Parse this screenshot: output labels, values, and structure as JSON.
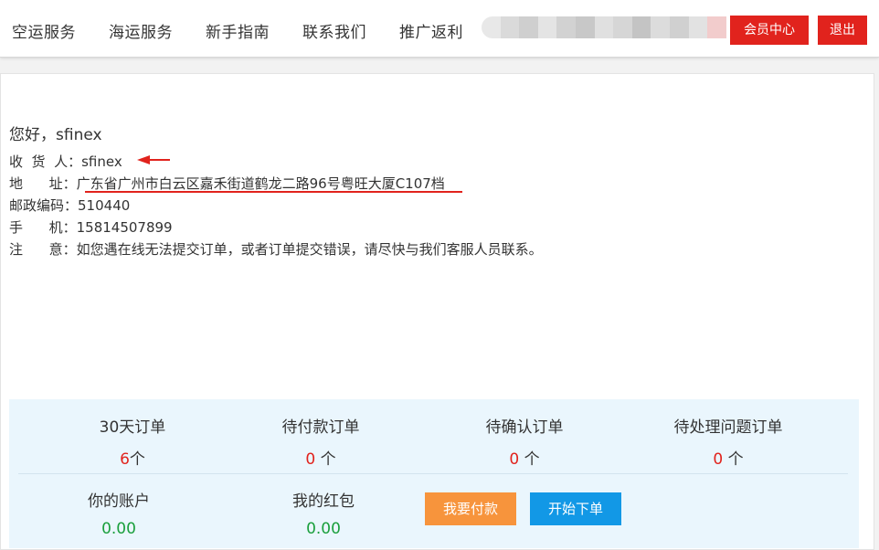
{
  "nav": {
    "items": [
      "空运服务",
      "海运服务",
      "新手指南",
      "联系我们",
      "推广返利"
    ],
    "member_center": "会员中心",
    "logout": "退出",
    "blur_colors": [
      "#e8e8e8",
      "#dadada",
      "#cfcfcf",
      "#e4e4e4",
      "#d2d2d2",
      "#c8c8c8",
      "#e0e0e0",
      "#d6d6d6",
      "#c4c4c4",
      "#dcdcdc",
      "#d0d0d0",
      "#e2e2e2",
      "#f2cccc"
    ]
  },
  "profile": {
    "greeting": "您好，sfinex",
    "receiver_label": "收  货  人：",
    "receiver": "sfinex",
    "address_label": "地      址：",
    "address": "广东省广州市白云区嘉禾街道鹤龙二路96号粤旺大厦C107档",
    "postcode_label": "邮政编码：",
    "postcode": "510440",
    "phone_label": "手      机：",
    "phone": "15814507899",
    "note_label": "注      意：",
    "note": "如您遇在线无法提交订单，或者订单提交错误，请尽快与我们客服人员联系。"
  },
  "stats": {
    "orders_30d": {
      "title": "30天订单",
      "count": "6",
      "unit": "个"
    },
    "pending_payment": {
      "title": "待付款订单",
      "count": "0",
      "unit": " 个"
    },
    "pending_confirm": {
      "title": "待确认订单",
      "count": "0",
      "unit": " 个"
    },
    "pending_issue": {
      "title": "待处理问题订单",
      "count": "0",
      "unit": " 个"
    },
    "account": {
      "title": "你的账户",
      "value": "0.00"
    },
    "red_packet": {
      "title": "我的红包",
      "value": "0.00"
    },
    "pay_button": "我要付款",
    "order_button": "开始下单"
  },
  "colors": {
    "brand_red": "#e1231d",
    "pay_orange": "#f7943c",
    "order_blue": "#1298e6",
    "stats_bg": "#eaf6fd",
    "money_green": "#1a9f3c"
  }
}
